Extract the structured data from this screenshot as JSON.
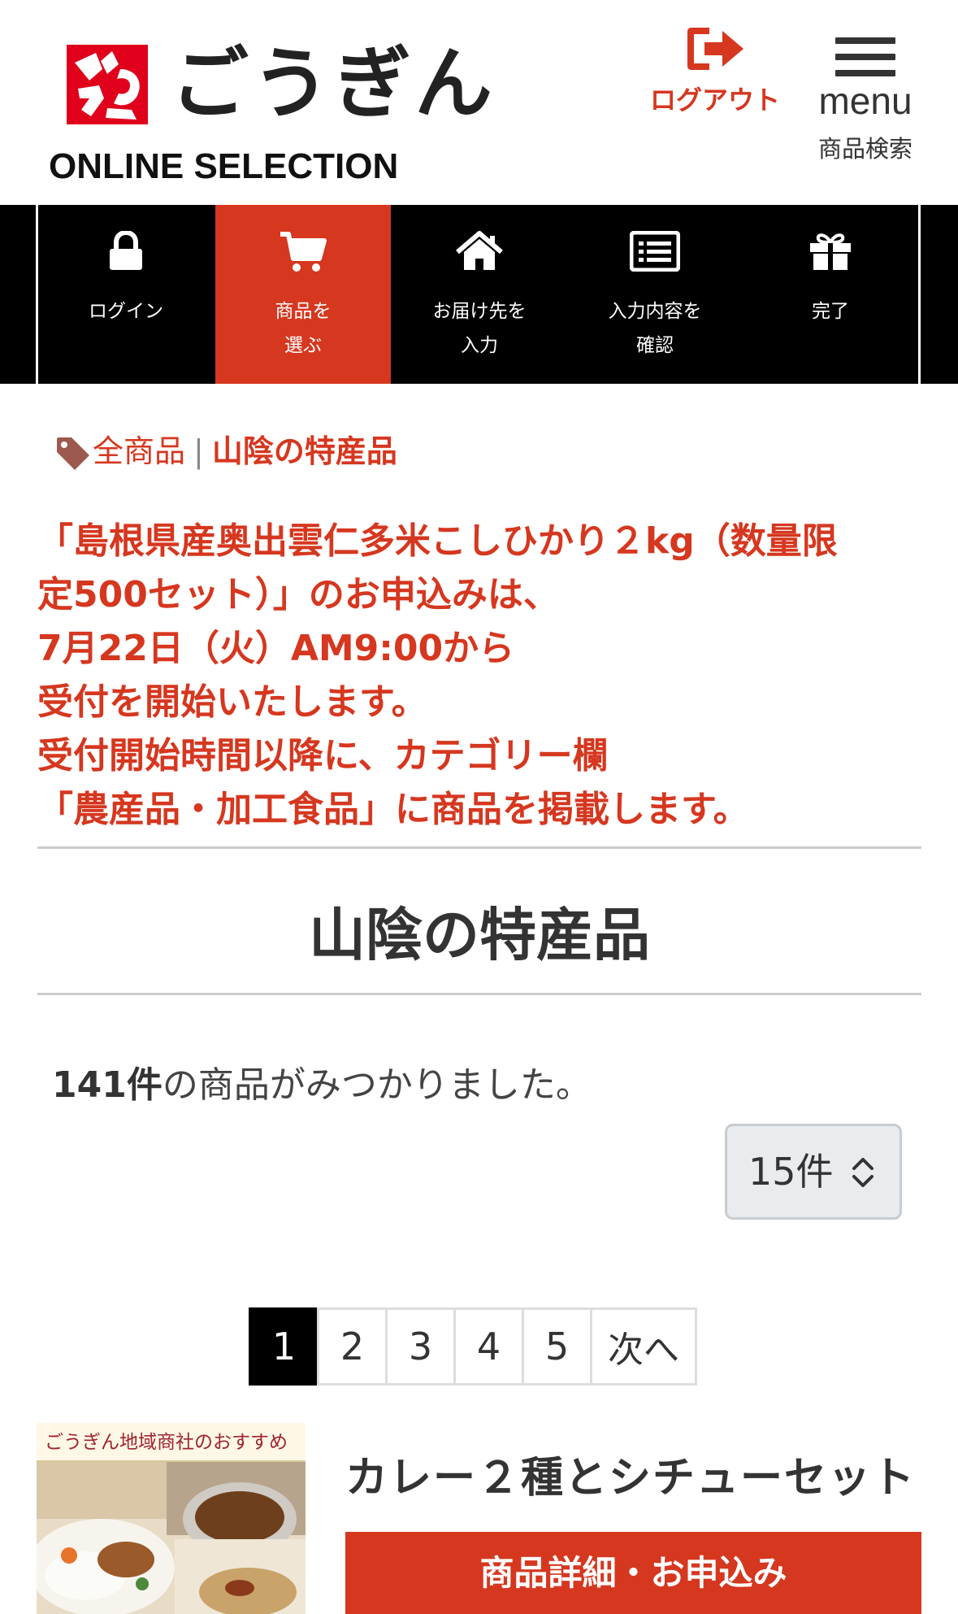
{
  "header": {
    "brand_name": "ごうぎん",
    "brand_sub": "ONLINE SELECTION",
    "logout_label": "ログアウト",
    "menu_label": "menu",
    "menu_sub_label": "商品検索"
  },
  "steps": [
    {
      "icon": "lock-icon",
      "label_line1": "ログイン",
      "label_line2": "",
      "active": false
    },
    {
      "icon": "cart-icon",
      "label_line1": "商品を",
      "label_line2": "選ぶ",
      "active": true
    },
    {
      "icon": "home-icon",
      "label_line1": "お届け先を",
      "label_line2": "入力",
      "active": false
    },
    {
      "icon": "list-icon",
      "label_line1": "入力内容を",
      "label_line2": "確認",
      "active": false
    },
    {
      "icon": "gift-icon",
      "label_line1": "完了",
      "label_line2": "",
      "active": false
    }
  ],
  "breadcrumb": {
    "all": "全商品",
    "separator": "|",
    "current": "山陰の特産品"
  },
  "notice": {
    "lines": [
      "「島根県産奥出雲仁多米こしひかり２kg（数量限",
      "定500セット）」のお申込みは、",
      "7月22日（火）AM9:00から",
      "受付を開始いたします。",
      "受付開始時間以降に、カテゴリー欄",
      "「農産品・加工食品」に商品を掲載します。"
    ]
  },
  "page_title": "山陰の特産品",
  "results": {
    "count": "141件",
    "suffix": "の商品がみつかりました。"
  },
  "per_page": {
    "selected": "15件"
  },
  "pagination": {
    "pages": [
      "1",
      "2",
      "3",
      "4",
      "5"
    ],
    "current": "1",
    "next_label": "次へ"
  },
  "products": [
    {
      "image_banner": "ごうぎん地域商社のおすすめ",
      "name": "カレー２種とシチューセット",
      "button_label": "商品詳細・お申込み"
    }
  ],
  "colors": {
    "accent": "#d6371f",
    "logo_red": "#e0001b",
    "nav_bg": "#000000"
  }
}
